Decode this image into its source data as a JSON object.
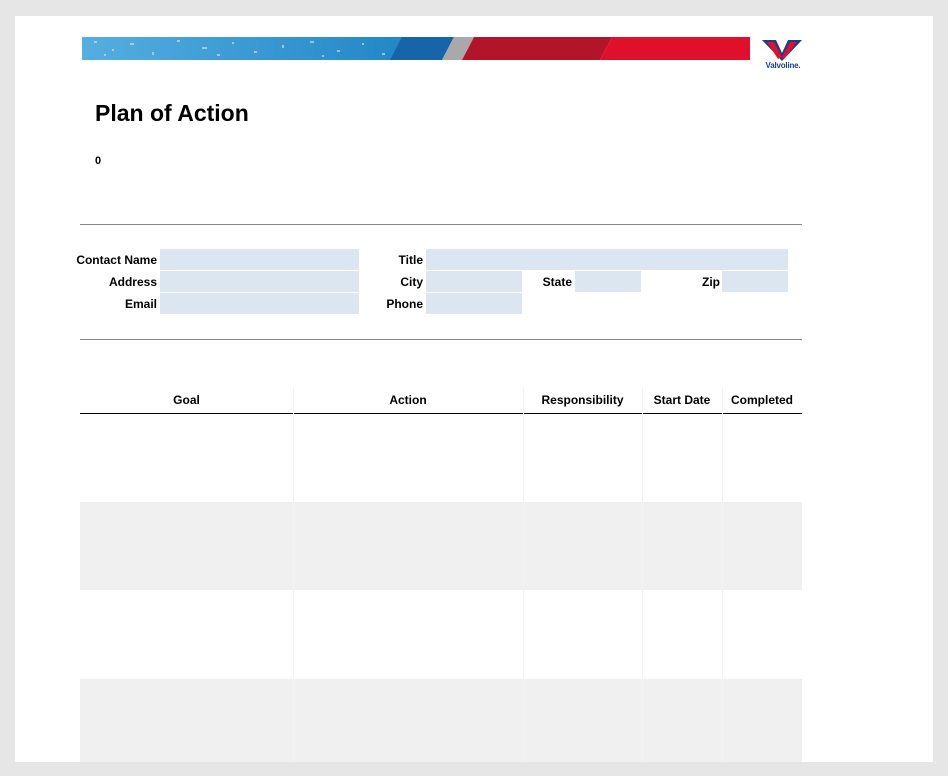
{
  "header": {
    "brand_name": "Valvoline."
  },
  "document": {
    "title": "Plan of Action",
    "subtitle": "0"
  },
  "contact_form": {
    "contact_name_label": "Contact Name",
    "contact_name_value": "",
    "address_label": "Address",
    "address_value": "",
    "email_label": "Email",
    "email_value": "",
    "title_label": "Title",
    "title_value": "",
    "city_label": "City",
    "city_value": "",
    "phone_label": "Phone",
    "phone_value": "",
    "state_label": "State",
    "state_value": "",
    "zip_label": "Zip",
    "zip_value": ""
  },
  "plan_table": {
    "columns": [
      "Goal",
      "Action",
      "Responsibility",
      "Start Date",
      "Completed"
    ],
    "rows": [
      [
        "",
        "",
        "",
        "",
        ""
      ],
      [
        "",
        "",
        "",
        "",
        ""
      ],
      [
        "",
        "",
        "",
        "",
        ""
      ],
      [
        "",
        "",
        "",
        "",
        ""
      ]
    ]
  },
  "colors": {
    "field_fill": "#dce6f1",
    "banner_blue": "#2a8fcc",
    "banner_red": "#d90d2b",
    "logo_blue": "#1a3e8c",
    "alt_row": "#f0f0f0"
  }
}
